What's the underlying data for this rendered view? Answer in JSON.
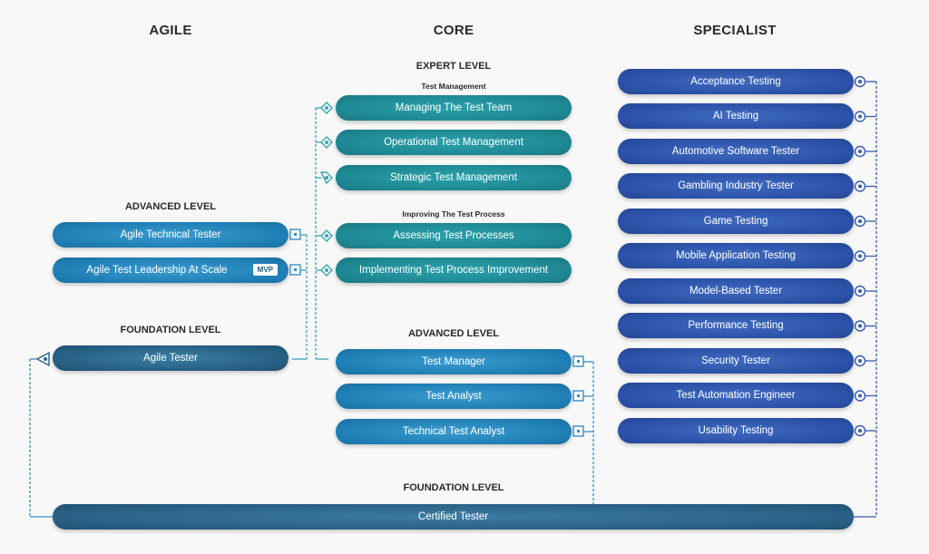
{
  "columns": {
    "agile": "AGILE",
    "core": "CORE",
    "specialist": "SPECIALIST"
  },
  "agile": {
    "advanced_level": "ADVANCED LEVEL",
    "advanced_items": [
      {
        "label": "Agile Technical Tester"
      },
      {
        "label": "Agile Test Leadership At Scale",
        "badge": "MVP"
      }
    ],
    "foundation_level": "FOUNDATION LEVEL",
    "foundation_items": [
      {
        "label": "Agile Tester"
      }
    ]
  },
  "core": {
    "expert_level": "EXPERT LEVEL",
    "test_management_heading": "Test Management",
    "test_management_items": [
      {
        "label": "Managing The Test Team"
      },
      {
        "label": "Operational Test Management"
      },
      {
        "label": "Strategic Test Management"
      }
    ],
    "improving_heading": "Improving The Test Process",
    "improving_items": [
      {
        "label": "Assessing Test Processes"
      },
      {
        "label": "Implementing Test Process Improvement"
      }
    ],
    "advanced_level": "ADVANCED LEVEL",
    "advanced_items": [
      {
        "label": "Test Manager"
      },
      {
        "label": "Test Analyst"
      },
      {
        "label": "Technical Test Analyst"
      }
    ]
  },
  "specialist": {
    "items": [
      {
        "label": "Acceptance Testing"
      },
      {
        "label": "AI Testing"
      },
      {
        "label": "Automotive Software Tester"
      },
      {
        "label": "Gambling Industry Tester"
      },
      {
        "label": "Game Testing"
      },
      {
        "label": "Mobile Application Testing"
      },
      {
        "label": "Model-Based Tester"
      },
      {
        "label": "Performance Testing"
      },
      {
        "label": "Security Tester"
      },
      {
        "label": "Test Automation Engineer"
      },
      {
        "label": "Usability Testing"
      }
    ]
  },
  "foundation": {
    "level": "FOUNDATION LEVEL",
    "label": "Certified Tester"
  },
  "colors": {
    "expert_teal": "#1e8892",
    "advanced_blue": "#1f7fb5",
    "specialist_blue": "#2b51a8",
    "foundation_navy": "#2a6086",
    "connector_teal": "#3aa6b0",
    "connector_blue": "#3b8fc8",
    "connector_navy": "#3a5cb0"
  }
}
